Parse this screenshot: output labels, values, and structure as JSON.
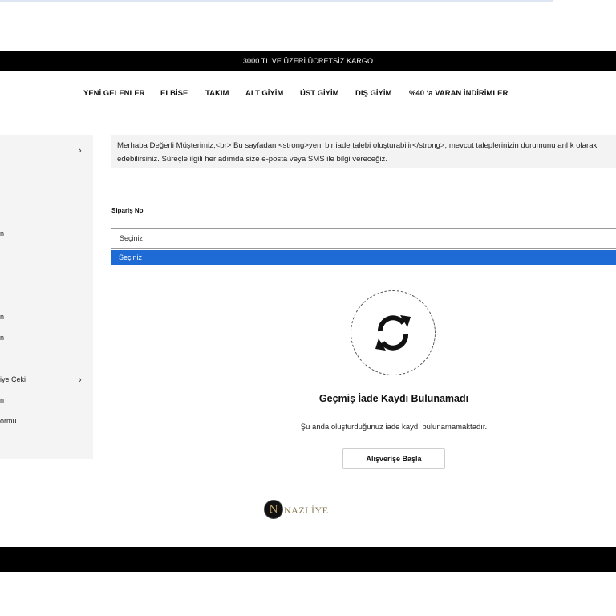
{
  "announcement": "3000 TL VE ÜZERİ ÜCRETSİZ KARGO",
  "nav": [
    {
      "label": "YENİ GELENLER"
    },
    {
      "label": "ELBİSE"
    },
    {
      "label": "TAKIM"
    },
    {
      "label": "ALT GİYİM"
    },
    {
      "label": "ÜST GİYİM"
    },
    {
      "label": "DIŞ GİYİM"
    },
    {
      "label": "%40 ‘a VARAN İNDİRİMLER"
    }
  ],
  "sidebar": {
    "items": [
      {
        "label": "n"
      },
      {
        "label": "n"
      },
      {
        "label": "n"
      },
      {
        "label": "iye Çeki"
      },
      {
        "label": "n"
      },
      {
        "label": "ormu"
      }
    ],
    "chevron": "›"
  },
  "info": {
    "line1": "Merhaba Değerli Müşterimiz,<br> Bu sayfadan <strong>yeni bir iade talebi oluşturabilir</strong>, mevcut taleplerinizin durumunu anlık olarak",
    "line2": "edebilirsiniz. Süreçle ilgili her adımda size e-posta veya SMS ile bilgi vereceğiz."
  },
  "order": {
    "label": "Sipariş No",
    "selected": "Seçiniz",
    "options": [
      "Seçiniz"
    ]
  },
  "empty_state": {
    "icon": "refresh-icon",
    "title": "Geçmiş İade Kaydı Bulunamadı",
    "description": "Şu anda oluşturduğunuz iade kaydı bulunamamaktadır.",
    "button": "Alışverişe Başla"
  },
  "logo": {
    "mark": "N",
    "word": "NAZLİYE"
  },
  "colors": {
    "accent": "#1f6bd6",
    "bar": "#000000"
  }
}
